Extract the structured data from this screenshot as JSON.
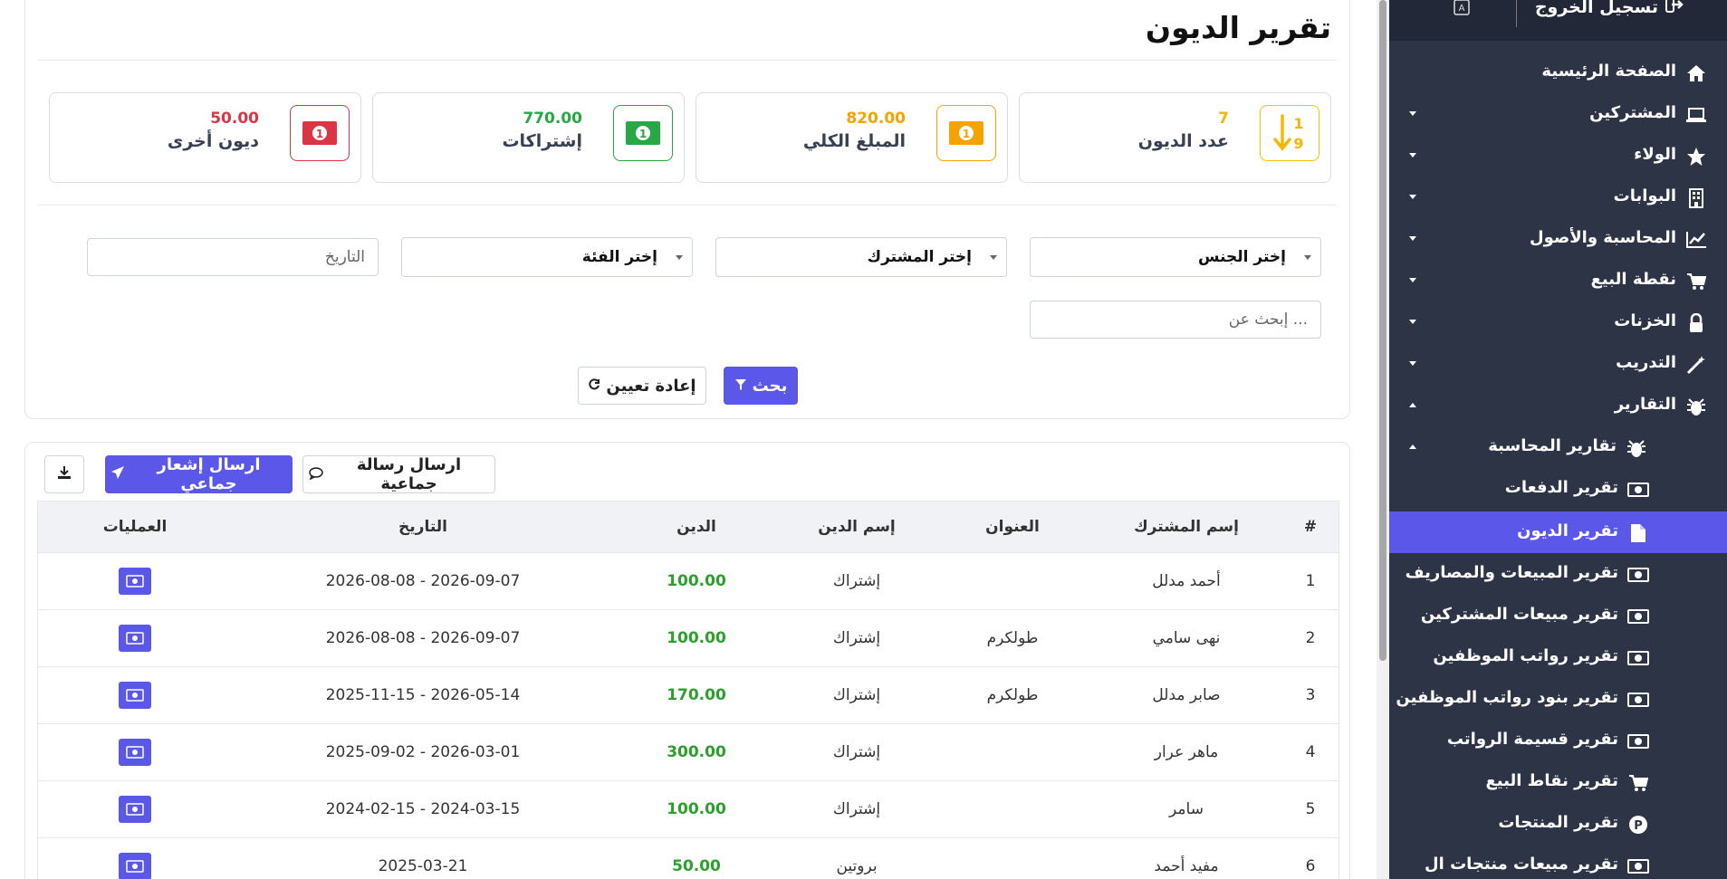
{
  "page": {
    "title": "تقرير الديون"
  },
  "stats": [
    {
      "value": "7",
      "label": "عدد الديون",
      "color": "#f5b800",
      "icon": "sort-numeric-icon"
    },
    {
      "value": "820.00",
      "label": "المبلغ الكلي",
      "color": "#f5a300",
      "icon": "money-bill-icon"
    },
    {
      "value": "770.00",
      "label": "إشتراكات",
      "color": "#28a745",
      "icon": "money-bill-icon"
    },
    {
      "value": "50.00",
      "label": "ديون أخرى",
      "color": "#dc3545",
      "icon": "money-bill-icon"
    }
  ],
  "filters": {
    "gender": "إختر الجنس",
    "subscriber": "إختر المشترك",
    "category": "إختر الفئة",
    "date_placeholder": "التاريخ",
    "search_placeholder": "إبحث عن ..."
  },
  "buttons": {
    "search": "بحث",
    "reset": "إعادة تعيين",
    "bulk_message": "ارسال رسالة جماعية",
    "bulk_notification": "ارسال إشعار جماعي"
  },
  "table": {
    "headers": [
      "#",
      "إسم المشترك",
      "العنوان",
      "إسم الدين",
      "الدين",
      "التاريخ",
      "العمليات"
    ],
    "rows": [
      {
        "num": "1",
        "name": "أحمد مدلل",
        "address": "",
        "debt_name": "إشتراك",
        "debt": "100.00",
        "date": "2026-09-07 - 2026-08-08"
      },
      {
        "num": "2",
        "name": "نهى سامي",
        "address": "طولكرم",
        "debt_name": "إشتراك",
        "debt": "100.00",
        "date": "2026-09-07 - 2026-08-08"
      },
      {
        "num": "3",
        "name": "صابر مدلل",
        "address": "طولكرم",
        "debt_name": "إشتراك",
        "debt": "170.00",
        "date": "2026-05-14 - 2025-11-15"
      },
      {
        "num": "4",
        "name": "ماهر عرار",
        "address": "",
        "debt_name": "إشتراك",
        "debt": "300.00",
        "date": "2026-03-01 - 2025-09-02"
      },
      {
        "num": "5",
        "name": "سامر",
        "address": "",
        "debt_name": "إشتراك",
        "debt": "100.00",
        "date": "2024-03-15 - 2024-02-15"
      },
      {
        "num": "6",
        "name": "مفيد أحمد",
        "address": "",
        "debt_name": "بروتين",
        "debt": "50.00",
        "date": "2025-03-21"
      }
    ]
  },
  "sidebar": {
    "logout": "تسجيل الخروج",
    "items": [
      {
        "label": "الصفحة الرئيسية",
        "icon": "home-icon"
      },
      {
        "label": "المشتركين",
        "icon": "laptop-icon"
      },
      {
        "label": "الولاء",
        "icon": "star-icon"
      },
      {
        "label": "البوابات",
        "icon": "building-icon"
      },
      {
        "label": "المحاسبة والأصول",
        "icon": "chart-line-icon"
      },
      {
        "label": "نقطة البيع",
        "icon": "cart-icon"
      },
      {
        "label": "الخزنات",
        "icon": "lock-icon"
      },
      {
        "label": "التدريب",
        "icon": "magic-wand-icon"
      },
      {
        "label": "التقارير",
        "icon": "bug-icon"
      },
      {
        "label": "تقارير المحاسبة",
        "icon": "bug-icon"
      },
      {
        "label": "تقرير الدفعات",
        "icon": "money-bill-icon"
      },
      {
        "label": "تقرير الديون",
        "icon": "file-icon"
      },
      {
        "label": "تقرير المبيعات والمصاريف",
        "icon": "money-bill-icon"
      },
      {
        "label": "تقرير مبيعات المشتركين",
        "icon": "money-bill-icon"
      },
      {
        "label": "تقرير رواتب الموظفين",
        "icon": "money-bill-icon"
      },
      {
        "label": "تقرير بنود رواتب الموظفين",
        "icon": "money-bill-icon"
      },
      {
        "label": "تقرير قسيمة الرواتب",
        "icon": "money-bill-icon"
      },
      {
        "label": "تقرير نقاط البيع",
        "icon": "cart-icon"
      },
      {
        "label": "تقرير المنتجات",
        "icon": "parking-icon"
      },
      {
        "label": "تقرير مبيعات منتجات ال",
        "icon": "money-bill-icon"
      }
    ]
  }
}
